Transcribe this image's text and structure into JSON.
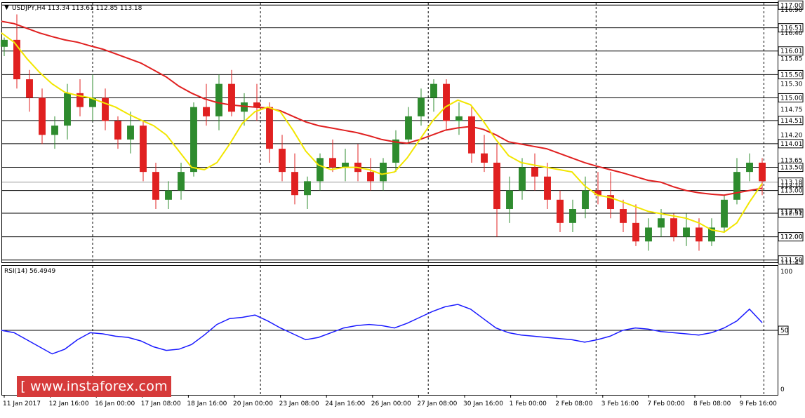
{
  "header": {
    "title": "USDJPY,H4  113.34 113.61 112.85 113.18"
  },
  "rsi_header": "RSI(14) 56.4949",
  "logo_text": "[ www.instaforex.com ]",
  "colors": {
    "bull": "#2e8b2e",
    "bear": "#e02020",
    "ma_slow": "#e02020",
    "ma_fast": "#f2e600",
    "rsi": "#1a1aff",
    "grid": "#000000",
    "logo": "#d63a3a"
  },
  "chart_data": [
    {
      "type": "candlestick",
      "title": "USDJPY,H4",
      "ohlc_header": {
        "open": 113.34,
        "high": 113.61,
        "low": 112.85,
        "close": 113.18
      },
      "ylim": [
        111.45,
        117.05
      ],
      "horizontal_levels": [
        117.0,
        116.51,
        116.01,
        115.5,
        115.0,
        114.51,
        114.01,
        113.5,
        113.0,
        112.51,
        112.0,
        111.5
      ],
      "current_price": 113.18,
      "price_axis_ticks": [
        "116.90",
        "116.40",
        "115.85",
        "115.30",
        "114.75",
        "114.20",
        "113.65",
        "113.10",
        "112.55",
        "112.00",
        "111.45"
      ],
      "x_ticks": [
        "11 Jan 2017",
        "12 Jan 16:00",
        "16 Jan 00:00",
        "17 Jan 08:00",
        "18 Jan 16:00",
        "20 Jan 00:00",
        "23 Jan 08:00",
        "24 Jan 16:00",
        "26 Jan 00:00",
        "27 Jan 08:00",
        "30 Jan 16:00",
        "1 Feb 00:00",
        "2 Feb 08:00",
        "3 Feb 16:00",
        "7 Feb 00:00",
        "8 Feb 08:00",
        "9 Feb 16:00"
      ],
      "series": [
        {
          "name": "slow MA",
          "values": [
            116.65,
            116.6,
            116.5,
            116.4,
            116.32,
            116.25,
            116.2,
            116.12,
            116.05,
            115.95,
            115.85,
            115.75,
            115.6,
            115.45,
            115.25,
            115.1,
            114.98,
            114.9,
            114.85,
            114.82,
            114.8,
            114.78,
            114.72,
            114.6,
            114.48,
            114.4,
            114.35,
            114.3,
            114.25,
            114.18,
            114.1,
            114.05,
            114.02,
            114.1,
            114.2,
            114.3,
            114.35,
            114.38,
            114.32,
            114.2,
            114.05,
            114.0,
            113.95,
            113.9,
            113.8,
            113.7,
            113.6,
            113.52,
            113.45,
            113.38,
            113.3,
            113.22,
            113.18,
            113.08,
            113.0,
            112.95,
            112.92,
            112.9,
            112.95,
            113.0,
            113.05
          ]
        },
        {
          "name": "fast MA",
          "values": [
            116.4,
            116.2,
            115.85,
            115.55,
            115.3,
            115.12,
            115.05,
            115.0,
            114.9,
            114.8,
            114.65,
            114.52,
            114.4,
            114.2,
            113.85,
            113.5,
            113.45,
            113.6,
            114.0,
            114.45,
            114.7,
            114.8,
            114.7,
            114.3,
            113.85,
            113.55,
            113.45,
            113.5,
            113.5,
            113.45,
            113.35,
            113.4,
            113.7,
            114.1,
            114.5,
            114.8,
            114.95,
            114.85,
            114.5,
            114.1,
            113.75,
            113.6,
            113.55,
            113.5,
            113.45,
            113.4,
            113.1,
            112.9,
            112.85,
            112.75,
            112.65,
            112.55,
            112.5,
            112.45,
            112.4,
            112.3,
            112.15,
            112.1,
            112.3,
            112.75,
            113.15
          ]
        }
      ],
      "candles": [
        [
          116.1,
          116.3,
          115.9,
          116.25
        ],
        [
          116.25,
          116.8,
          115.2,
          115.4
        ],
        [
          115.4,
          115.6,
          114.7,
          115.0
        ],
        [
          115.0,
          115.2,
          114.0,
          114.2
        ],
        [
          114.2,
          114.6,
          113.9,
          114.4
        ],
        [
          114.4,
          115.3,
          114.1,
          115.1
        ],
        [
          115.1,
          115.4,
          114.6,
          114.8
        ],
        [
          114.8,
          115.5,
          114.5,
          115.0
        ],
        [
          115.0,
          115.2,
          114.3,
          114.5
        ],
        [
          114.5,
          114.6,
          113.9,
          114.1
        ],
        [
          114.1,
          114.7,
          113.8,
          114.4
        ],
        [
          114.4,
          114.5,
          113.2,
          113.4
        ],
        [
          113.4,
          113.6,
          112.6,
          112.8
        ],
        [
          112.8,
          113.2,
          112.6,
          113.0
        ],
        [
          113.0,
          113.6,
          112.8,
          113.4
        ],
        [
          113.4,
          114.9,
          113.3,
          114.8
        ],
        [
          114.8,
          115.3,
          114.4,
          114.6
        ],
        [
          114.6,
          115.5,
          114.3,
          115.3
        ],
        [
          115.3,
          115.6,
          114.6,
          114.7
        ],
        [
          114.7,
          115.1,
          114.4,
          114.9
        ],
        [
          114.9,
          115.3,
          114.5,
          114.8
        ],
        [
          114.8,
          114.9,
          113.6,
          113.9
        ],
        [
          113.9,
          114.2,
          113.2,
          113.4
        ],
        [
          113.4,
          113.8,
          112.7,
          112.9
        ],
        [
          112.9,
          113.3,
          112.6,
          113.2
        ],
        [
          113.2,
          113.8,
          113.0,
          113.7
        ],
        [
          113.7,
          114.1,
          113.4,
          113.5
        ],
        [
          113.5,
          113.9,
          113.2,
          113.6
        ],
        [
          113.6,
          114.0,
          113.2,
          113.4
        ],
        [
          113.4,
          113.7,
          113.0,
          113.2
        ],
        [
          113.2,
          113.7,
          113.0,
          113.6
        ],
        [
          113.6,
          114.3,
          113.4,
          114.1
        ],
        [
          114.1,
          114.8,
          114.0,
          114.6
        ],
        [
          114.6,
          115.2,
          114.4,
          115.0
        ],
        [
          115.0,
          115.4,
          114.7,
          115.3
        ],
        [
          115.3,
          115.4,
          114.3,
          114.5
        ],
        [
          114.5,
          114.9,
          114.2,
          114.6
        ],
        [
          114.6,
          114.8,
          113.6,
          113.8
        ],
        [
          113.8,
          114.2,
          113.4,
          113.6
        ],
        [
          113.6,
          114.0,
          112.0,
          112.6
        ],
        [
          112.6,
          113.3,
          112.3,
          113.0
        ],
        [
          113.0,
          113.7,
          112.8,
          113.5
        ],
        [
          113.5,
          113.8,
          113.0,
          113.3
        ],
        [
          113.3,
          113.6,
          112.6,
          112.8
        ],
        [
          112.8,
          113.0,
          112.1,
          112.3
        ],
        [
          112.3,
          112.8,
          112.1,
          112.6
        ],
        [
          112.6,
          113.3,
          112.4,
          113.0
        ],
        [
          113.0,
          113.4,
          112.7,
          112.9
        ],
        [
          112.9,
          113.4,
          112.4,
          112.6
        ],
        [
          112.6,
          112.8,
          112.1,
          112.3
        ],
        [
          112.3,
          112.7,
          111.8,
          111.9
        ],
        [
          111.9,
          112.4,
          111.7,
          112.2
        ],
        [
          112.2,
          112.6,
          112.0,
          112.4
        ],
        [
          112.4,
          112.5,
          111.9,
          112.0
        ],
        [
          112.0,
          112.5,
          111.8,
          112.2
        ],
        [
          112.2,
          112.4,
          111.7,
          111.9
        ],
        [
          111.9,
          112.4,
          111.8,
          112.2
        ],
        [
          112.2,
          112.9,
          112.1,
          112.8
        ],
        [
          112.8,
          113.7,
          112.7,
          113.4
        ],
        [
          113.4,
          113.8,
          113.2,
          113.6
        ],
        [
          113.6,
          113.7,
          112.9,
          113.2
        ]
      ]
    },
    {
      "type": "line",
      "title": "RSI(14) 56.4949",
      "ylim": [
        0,
        100
      ],
      "y_ticks": [
        "100",
        "50",
        "0"
      ],
      "series": [
        {
          "name": "RSI(14)",
          "values": [
            50,
            48,
            42,
            36,
            30,
            34,
            42,
            48,
            47,
            45,
            44,
            41,
            36,
            33,
            34,
            38,
            46,
            55,
            60,
            61,
            63,
            58,
            52,
            47,
            42,
            44,
            48,
            52,
            54,
            55,
            54,
            52,
            56,
            61,
            66,
            70,
            72,
            68,
            60,
            52,
            48,
            46,
            45,
            44,
            43,
            42,
            40,
            42,
            45,
            50,
            52,
            51,
            49,
            48,
            47,
            46,
            48,
            52,
            58,
            68,
            56.49
          ]
        }
      ]
    }
  ]
}
